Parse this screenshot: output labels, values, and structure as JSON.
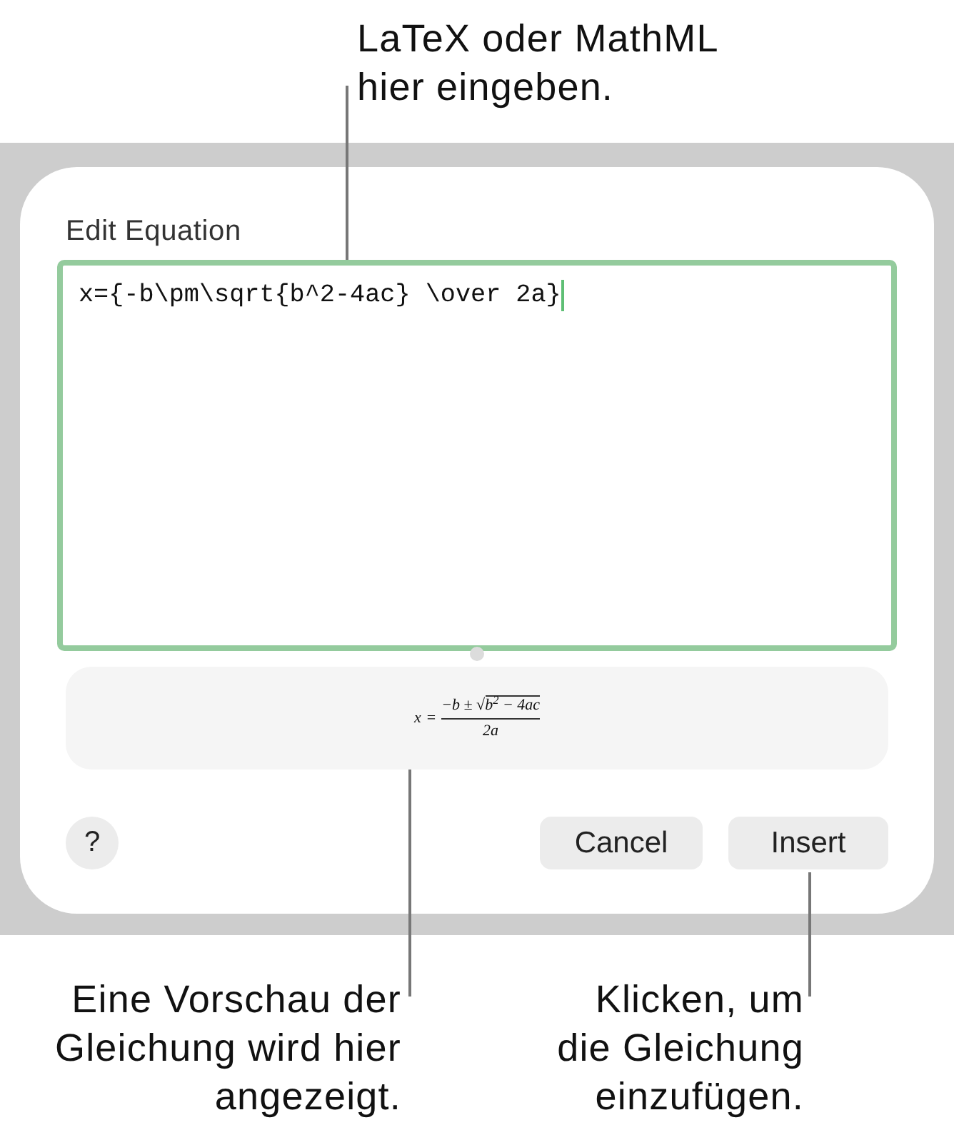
{
  "callout_top": "LaTeX oder MathML\nhier eingeben.",
  "dialog": {
    "title": "Edit Equation",
    "field": {
      "value": "x={-b\\pm\\sqrt{b^2-4ac} \\over 2a}",
      "focused": true
    },
    "preview": {
      "variable": "x",
      "relation": "=",
      "numerator": "−b ±",
      "radical": "√",
      "radicand": "b$^{2}$ − 4ac",
      "denominator": "2a"
    },
    "help_button": "?",
    "buttons": [
      "Cancel",
      "Insert"
    ]
  },
  "callouts_bottom": [
    "Eine Vorschau der\nGleichung wird hier\nangezeigt.",
    "Klicken, um\ndie Gleichung\neinzufügen."
  ]
}
